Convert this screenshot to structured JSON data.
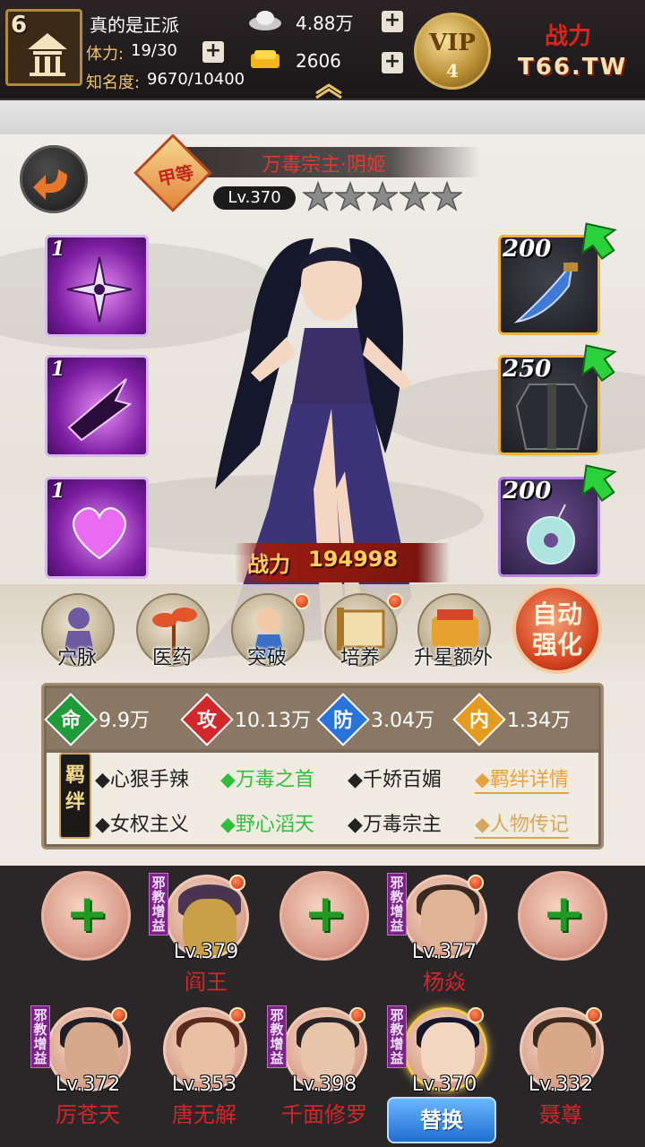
{
  "player": {
    "level": "6",
    "name": "真的是正派",
    "stamina_label": "体力:",
    "stamina_value": "19/30",
    "fame_label": "知名度:",
    "fame_value": "9670/10400"
  },
  "currency": {
    "silver": "4.88万",
    "gold": "2606"
  },
  "vip": {
    "label": "VIP",
    "level": "4"
  },
  "logo": {
    "line1": "战力",
    "line2": "T66.TW"
  },
  "hero": {
    "grade": "甲等",
    "name": "万毒宗主·阴姬",
    "level": "Lv.370",
    "stars": 5,
    "power_label": "战力",
    "power_value": "194998"
  },
  "skills": [
    {
      "level": "1",
      "icon": "shuriken-icon"
    },
    {
      "level": "1",
      "icon": "dart-icon"
    },
    {
      "level": "1",
      "icon": "heart-icon"
    }
  ],
  "equipment": [
    {
      "level": "200",
      "icon": "dagger-icon"
    },
    {
      "level": "250",
      "icon": "armor-icon"
    },
    {
      "level": "200",
      "icon": "jade-pendant-icon"
    }
  ],
  "menu": [
    {
      "label": "穴脉",
      "icon": "meridian-icon",
      "dot": false
    },
    {
      "label": "医药",
      "icon": "herb-icon",
      "dot": false
    },
    {
      "label": "突破",
      "icon": "breakthrough-icon",
      "dot": true
    },
    {
      "label": "培养",
      "icon": "scroll-icon",
      "dot": true
    },
    {
      "label": "升星额外",
      "icon": "star-up-icon",
      "dot": false
    }
  ],
  "auto_enhance": {
    "line1": "自动",
    "line2": "强化"
  },
  "attributes": [
    {
      "glyph": "命",
      "value": "9.9万",
      "color": "#1f9b3a"
    },
    {
      "glyph": "攻",
      "value": "10.13万",
      "color": "#d3282b"
    },
    {
      "glyph": "防",
      "value": "3.04万",
      "color": "#2a73d8"
    },
    {
      "glyph": "内",
      "value": "1.34万",
      "color": "#e49b20"
    }
  ],
  "bond": {
    "tag": "羁绊",
    "items": [
      "◆心狠手辣",
      "◆万毒之首",
      "◆千娇百媚",
      "◆羁绊详情",
      "◆女权主义",
      "◆野心滔天",
      "◆万毒宗主",
      "◆人物传记"
    ]
  },
  "formation": {
    "sect_tag": "邪教增益",
    "row1": [
      {
        "type": "empty"
      },
      {
        "type": "hero",
        "level": "Lv.379",
        "name": "阎王"
      },
      {
        "type": "empty"
      },
      {
        "type": "hero",
        "level": "Lv.377",
        "name": "杨焱"
      },
      {
        "type": "empty"
      }
    ],
    "row2": [
      {
        "level": "Lv.372",
        "name": "厉苍天"
      },
      {
        "level": "Lv.353",
        "name": "唐无解"
      },
      {
        "level": "Lv.398",
        "name": "千面修罗"
      },
      {
        "level": "Lv.370",
        "name": ""
      },
      {
        "level": "Lv.332",
        "name": "聂尊"
      }
    ],
    "swap_label": "替换"
  }
}
